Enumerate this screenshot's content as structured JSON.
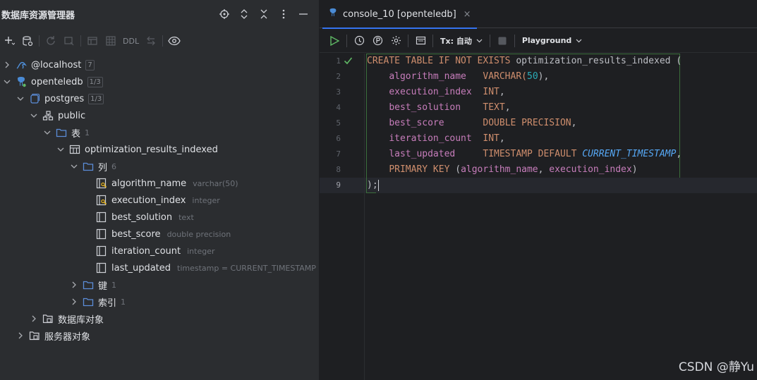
{
  "left_panel": {
    "title": "数据库资源管理器",
    "toolbar_ddl": "DDL",
    "tree": [
      {
        "label": "@localhost",
        "badge": "7"
      },
      {
        "label": "openteledb",
        "badge": "1/3"
      },
      {
        "label": "postgres",
        "badge": "1/3"
      },
      {
        "label": "public"
      },
      {
        "label": "表",
        "count": "1"
      },
      {
        "label": "optimization_results_indexed"
      },
      {
        "label": "列",
        "count": "6"
      },
      {
        "label": "algorithm_name",
        "type": "varchar(50)"
      },
      {
        "label": "execution_index",
        "type": "integer"
      },
      {
        "label": "best_solution",
        "type": "text"
      },
      {
        "label": "best_score",
        "type": "double precision"
      },
      {
        "label": "iteration_count",
        "type": "integer"
      },
      {
        "label": "last_updated",
        "type": "timestamp = CURRENT_TIMESTAMP"
      },
      {
        "label": "键",
        "count": "1"
      },
      {
        "label": "索引",
        "count": "1"
      },
      {
        "label": "数据库对象"
      },
      {
        "label": "服务器对象"
      }
    ]
  },
  "editor": {
    "tab_title": "console_10 [openteledb]",
    "tab_close": "×",
    "tx_label": "Tx: 自动",
    "playground_label": "Playground",
    "line_numbers": [
      "1",
      "2",
      "3",
      "4",
      "5",
      "6",
      "7",
      "8",
      "9"
    ],
    "code": {
      "l1_kw": "CREATE TABLE IF NOT EXISTS",
      "l1_name": " optimization_results_indexed (",
      "l2_col": "algorithm_name",
      "l2_type": "VARCHAR(",
      "l2_num": "50",
      "l2_end": "),",
      "l3_col": "execution_index",
      "l3_type": "INT",
      "l4_col": "best_solution",
      "l4_type": "TEXT",
      "l5_col": "best_score",
      "l5_type": "DOUBLE PRECISION",
      "l6_col": "iteration_count",
      "l6_type": "INT",
      "l7_col": "last_updated",
      "l7_type": "TIMESTAMP DEFAULT",
      "l7_fn": "CURRENT_TIMESTAMP",
      "l8_kw": "PRIMARY KEY",
      "l8_open": " (",
      "l8_a": "algorithm_name",
      "l8_comma": ", ",
      "l8_b": "execution_index",
      "l8_close": ")",
      "l9_a": ")",
      "l9_b": ";"
    }
  },
  "watermark": "CSDN @静Yu",
  "colors": {
    "accent": "#3574f0",
    "run": "#5fb865",
    "keyword": "#cf8e6d",
    "column": "#c77dbb",
    "number": "#2aacb8",
    "function": "#56a8f5"
  }
}
